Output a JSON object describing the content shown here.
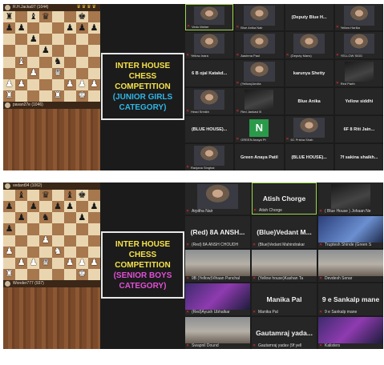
{
  "top": {
    "player_top": "R.H.Jacka97 (1044)",
    "player_bottom": "pavan27e (1046)",
    "crowns": "♛♛♛♛",
    "board": [
      [
        "br",
        "",
        "bb",
        "bq",
        "",
        "",
        "bk",
        ""
      ],
      [
        "bp",
        "bp",
        "",
        "",
        "",
        "bp",
        "bp",
        "bp"
      ],
      [
        "",
        "",
        "bp",
        "",
        "",
        "",
        "",
        ""
      ],
      [
        "",
        "",
        "",
        "bp",
        "",
        "",
        "",
        ""
      ],
      [
        "",
        "wb",
        "",
        "",
        "bn",
        "",
        "",
        ""
      ],
      [
        "",
        "",
        "wp",
        "",
        "wq",
        "",
        "",
        ""
      ],
      [
        "wp",
        "wp",
        "",
        "",
        "",
        "wp",
        "wp",
        "wp"
      ],
      [
        "wr",
        "",
        "",
        "",
        "wr",
        "",
        "wk",
        ""
      ]
    ],
    "banner": {
      "line1": "INTER HOUSE",
      "line2": "CHESS",
      "line3": "COMPETITION",
      "line4": "(JUNIOR GIRLS",
      "line5": "CATEGORY)"
    },
    "tiles": [
      {
        "name": "",
        "cap": "Vedo Meher",
        "cam": "face",
        "speaking": true
      },
      {
        "name": "",
        "cap": "Blue Anika Nair",
        "cam": "face"
      },
      {
        "name": "(Deputy Blue H...",
        "cap": ""
      },
      {
        "name": "",
        "cap": "Yellow Harika",
        "cam": "face"
      },
      {
        "name": "",
        "cap": "Yellow-Inara",
        "cam": "face"
      },
      {
        "name": "",
        "cap": "Aashma Paul",
        "cam": "face"
      },
      {
        "name": "",
        "cap": "(Deputy Mans)",
        "cam": "face"
      },
      {
        "name": "",
        "cap": "YELLOW SIDD",
        "cam": "face"
      },
      {
        "name": "6 B ojal Katakd...",
        "cap": ""
      },
      {
        "name": "",
        "cap": "(Yellow)Anvita",
        "cam": "face"
      },
      {
        "name": "karunya Shetty",
        "cap": ""
      },
      {
        "name": "",
        "cap": "Red Parth",
        "cam": "dark"
      },
      {
        "name": "",
        "cap": "Head Srinikh",
        "cam": "face"
      },
      {
        "name": "",
        "cap": "Red Jankavi B",
        "cam": "dark"
      },
      {
        "name": "Blue Anika",
        "cap": ""
      },
      {
        "name": "Yellow siddhi",
        "cap": ""
      },
      {
        "name": "(BLUE HOUSE)...",
        "cap": ""
      },
      {
        "name": "",
        "cap": "GREEN Anaya Pt",
        "avatar": "N"
      },
      {
        "name": "",
        "cap": "6C Prisha Shah",
        "cam": "face"
      },
      {
        "name": "6F   8   Riti Jain...",
        "cap": ""
      },
      {
        "name": "",
        "cap": "Ranjana Singhal",
        "cam": "face"
      },
      {
        "name": "Green Anaya Patil",
        "cap": ""
      },
      {
        "name": "(BLUE HOUSE)...",
        "cap": ""
      },
      {
        "name": "7f  sakina shaikh...",
        "cap": ""
      }
    ]
  },
  "bottom": {
    "player_top": "vedant94 (1062)",
    "player_bottom": "Wonder777 (937)",
    "board": [
      [
        "",
        "bb",
        "",
        "bq",
        "",
        "bb",
        "bk",
        ""
      ],
      [
        "bp",
        "",
        "bp",
        "",
        "bp",
        "bp",
        "",
        "bp"
      ],
      [
        "",
        "bp",
        "",
        "bn",
        "",
        "",
        "bp",
        ""
      ],
      [
        "bp",
        "",
        "",
        "",
        "",
        "",
        "",
        ""
      ],
      [
        "",
        "",
        "",
        "wp",
        "",
        "",
        "",
        ""
      ],
      [
        "wp",
        "",
        "",
        "",
        "wn",
        "",
        "",
        ""
      ],
      [
        "",
        "wp",
        "wp",
        "wq",
        "",
        "wp",
        "wp",
        "wp"
      ],
      [
        "wr",
        "",
        "",
        "",
        "",
        "",
        "wk",
        ""
      ]
    ],
    "banner": {
      "line1": "INTER HOUSE",
      "line2": "CHESS",
      "line3": "COMPETITION",
      "line4": "(SENIOR BOYS",
      "line5": "CATEGORY)"
    },
    "tiles": [
      {
        "name": "",
        "cap": "Arpitha Nair",
        "cam": "face"
      },
      {
        "name": "Atish Chorge",
        "cap": "Atish Chorge",
        "speaking": true
      },
      {
        "name": "",
        "cap": "( Blue House ) Johaan Ne",
        "cam": "dark"
      },
      {
        "name": "(Red) 8A  ANSH...",
        "cap": "(Red) 8A ANSH CHOUDH"
      },
      {
        "name": "(Blue)Vedant  M...",
        "cap": "(Blue)Vedant Mahindrakar"
      },
      {
        "name": "",
        "cap": "Truptesh Shinde (Green S",
        "cam": "blue"
      },
      {
        "name": "",
        "cap": "9B (Yellow)Vihaan Panchal",
        "cam": "room"
      },
      {
        "name": "",
        "cap": "(Yellow house)Kashan Ta",
        "cam": "room"
      },
      {
        "name": "",
        "cap": "Devdesh Sonar",
        "cam": "room"
      },
      {
        "name": "",
        "cap": "(Red)Ayush Ubhalkar",
        "cam": "game"
      },
      {
        "name": "Manika Pal",
        "cap": "Manika Pal"
      },
      {
        "name": "9 e Sankalp mane",
        "cap": "9 e Sankalp mane"
      },
      {
        "name": "",
        "cap": "Swapnil Dound",
        "cam": "room"
      },
      {
        "name": "Gautamraj  yada...",
        "cap": "Gautamraj yadav (9f yell"
      },
      {
        "name": "",
        "cap": "Kalisters",
        "cam": "game"
      }
    ]
  },
  "icons": {
    "mic_off": "mic-off-icon"
  },
  "colors": {
    "banner_title": "#f5e24a",
    "junior": "#2fb6e6",
    "senior": "#e24fd6",
    "speaker": "#9ed84a"
  }
}
